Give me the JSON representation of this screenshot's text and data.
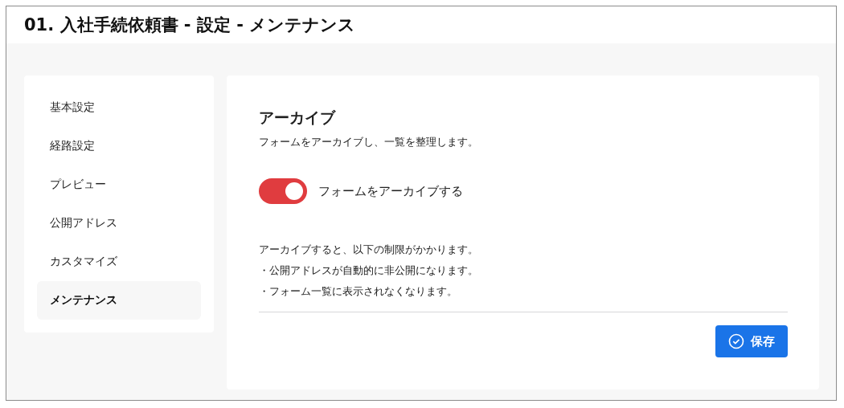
{
  "window": {
    "title": "01. 入社手続依頼書 - 設定 - メンテナンス"
  },
  "sidebar": {
    "items": [
      {
        "label": "基本設定",
        "selected": false
      },
      {
        "label": "経路設定",
        "selected": false
      },
      {
        "label": "プレビュー",
        "selected": false
      },
      {
        "label": "公開アドレス",
        "selected": false
      },
      {
        "label": "カスタマイズ",
        "selected": false
      },
      {
        "label": "メンテナンス",
        "selected": true
      }
    ]
  },
  "section": {
    "title": "アーカイブ",
    "description": "フォームをアーカイブし、一覧を整理します。",
    "toggle": {
      "label": "フォームをアーカイブする",
      "on": true
    },
    "notes": [
      "アーカイブすると、以下の制限がかかります。",
      "・公開アドレスが自動的に非公開になります。",
      "・フォーム一覧に表示されなくなります。"
    ]
  },
  "buttons": [
    {
      "label": "保存"
    }
  ]
}
